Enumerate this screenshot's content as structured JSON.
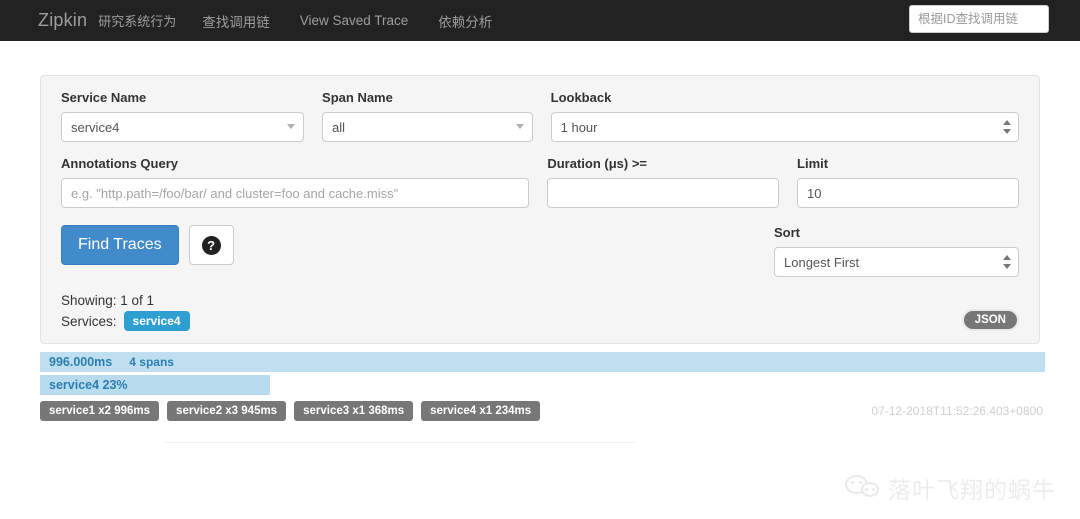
{
  "navbar": {
    "brand": "Zipkin",
    "brand_sub": "研究系统行为",
    "links": [
      {
        "label": "查找调用链"
      },
      {
        "label": "View Saved Trace"
      },
      {
        "label": "依赖分析"
      }
    ],
    "search_placeholder": "根据ID查找调用链",
    "search_value": "",
    "background": "#222222"
  },
  "search_form": {
    "service_name": {
      "label": "Service Name",
      "value": "service4"
    },
    "span_name": {
      "label": "Span Name",
      "value": "all"
    },
    "lookback": {
      "label": "Lookback",
      "value": "1 hour"
    },
    "annotations_query": {
      "label": "Annotations Query",
      "value": "",
      "placeholder": "e.g. \"http.path=/foo/bar/ and cluster=foo and cache.miss\""
    },
    "duration": {
      "label": "Duration (μs) >=",
      "value": "",
      "placeholder": ""
    },
    "limit": {
      "label": "Limit",
      "value": "10"
    },
    "sort": {
      "label": "Sort",
      "value": "Longest First"
    },
    "find_button": "Find Traces",
    "help_button": "?",
    "accent_color": "#428bca"
  },
  "summary": {
    "showing": "Showing: 1 of 1",
    "services_label": "Services:",
    "service_badges": [
      "service4"
    ],
    "json_button": "JSON",
    "badge_color": "#2d9fd0"
  },
  "results": {
    "traces": [
      {
        "duration": "996.000ms",
        "spans": "4 spans",
        "bar_label": "service4 23%",
        "bar_percent": 23,
        "timestamp": "07-12-2018T11:52:26.403+0800",
        "services": [
          "service1 x2 996ms",
          "service2 x3 945ms",
          "service3 x1 368ms",
          "service4 x1 234ms"
        ]
      }
    ],
    "bar_color": "#b8dcee",
    "head_color": "#bfdff0"
  },
  "watermark": {
    "text": "落叶飞翔的蜗牛"
  }
}
